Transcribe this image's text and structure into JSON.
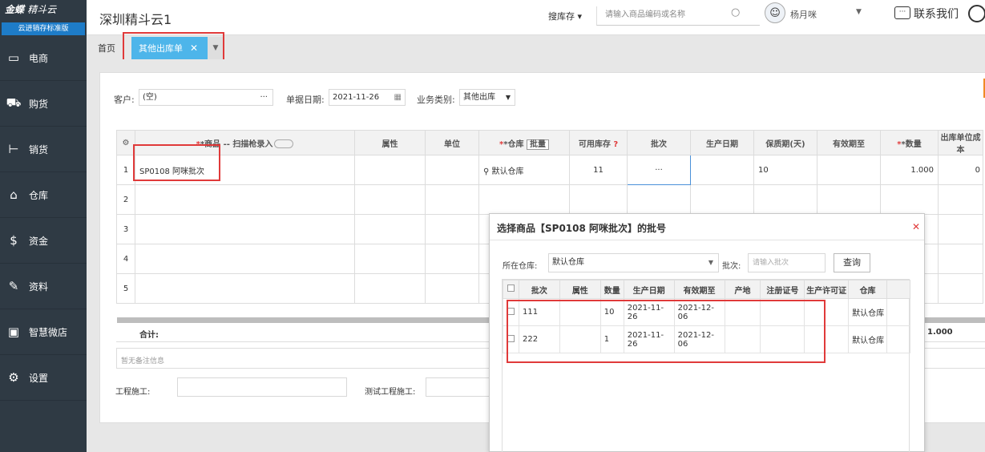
{
  "sidebar": {
    "logo_main": "金蝶",
    "logo_sub": "精斗云",
    "edition": "云进销存标准版",
    "items": [
      {
        "label": "电商",
        "icon": "store-icon"
      },
      {
        "label": "购货",
        "icon": "cart-icon"
      },
      {
        "label": "销货",
        "icon": "sales-icon"
      },
      {
        "label": "仓库",
        "icon": "warehouse-icon"
      },
      {
        "label": "资金",
        "icon": "money-icon"
      },
      {
        "label": "资料",
        "icon": "pen-icon"
      },
      {
        "label": "智慧微店",
        "icon": "shop-icon"
      },
      {
        "label": "设置",
        "icon": "gear-icon"
      }
    ]
  },
  "topbar": {
    "title": "深圳精斗云1",
    "search_scope": "搜库存",
    "search_placeholder": "请输入商品编码或名称",
    "username": "杨月咪",
    "contact": "联系我们"
  },
  "tabs": {
    "home": "首页",
    "active": "其他出库单"
  },
  "form": {
    "customer_label": "客户:",
    "customer_value": "(空)",
    "date_label": "单据日期:",
    "date_value": "2021-11-26",
    "biz_label": "业务类别:",
    "biz_value": "其他出库"
  },
  "grid": {
    "headers": [
      "*商品 -- 扫描枪录入",
      "属性",
      "单位",
      "*仓库",
      "可用库存",
      "批次",
      "生产日期",
      "保质期(天)",
      "有效期至",
      "*数量",
      "出库单位成本"
    ],
    "batch_btn": "批量",
    "rows": [
      {
        "no": "1",
        "product": "SP0108 阿咪批次",
        "warehouse": "默认仓库",
        "stock": "11",
        "batch": "···",
        "shelf": "10",
        "qty": "1.000",
        "cost": "0"
      },
      {
        "no": "2"
      },
      {
        "no": "3"
      },
      {
        "no": "4"
      },
      {
        "no": "5"
      }
    ],
    "total_label": "合计:",
    "total_qty": "1.000"
  },
  "remark_placeholder": "暂无备注信息",
  "footer": {
    "field1": "工程施工:",
    "field2": "测试工程施工:"
  },
  "modal": {
    "title": "选择商品【SP0108 阿咪批次】的批号",
    "warehouse_label": "所在仓库:",
    "warehouse_value": "默认仓库",
    "batch_label": "批次:",
    "batch_placeholder": "请输入批次",
    "query_btn": "查询",
    "headers": [
      "批次",
      "属性",
      "数量",
      "生产日期",
      "有效期至",
      "产地",
      "注册证号",
      "生产许可证",
      "仓库"
    ],
    "rows": [
      {
        "batch": "111",
        "qty": "10",
        "prod_date": "2021-11-26",
        "expiry": "2021-12-06",
        "warehouse": "默认仓库"
      },
      {
        "batch": "222",
        "qty": "1",
        "prod_date": "2021-11-26",
        "expiry": "2021-12-06",
        "warehouse": "默认仓库"
      }
    ]
  },
  "colors": {
    "sidebar": "#2f3a44",
    "tab_active": "#4db5ea",
    "highlight": "#e03a3a",
    "accent": "#f08a24"
  }
}
